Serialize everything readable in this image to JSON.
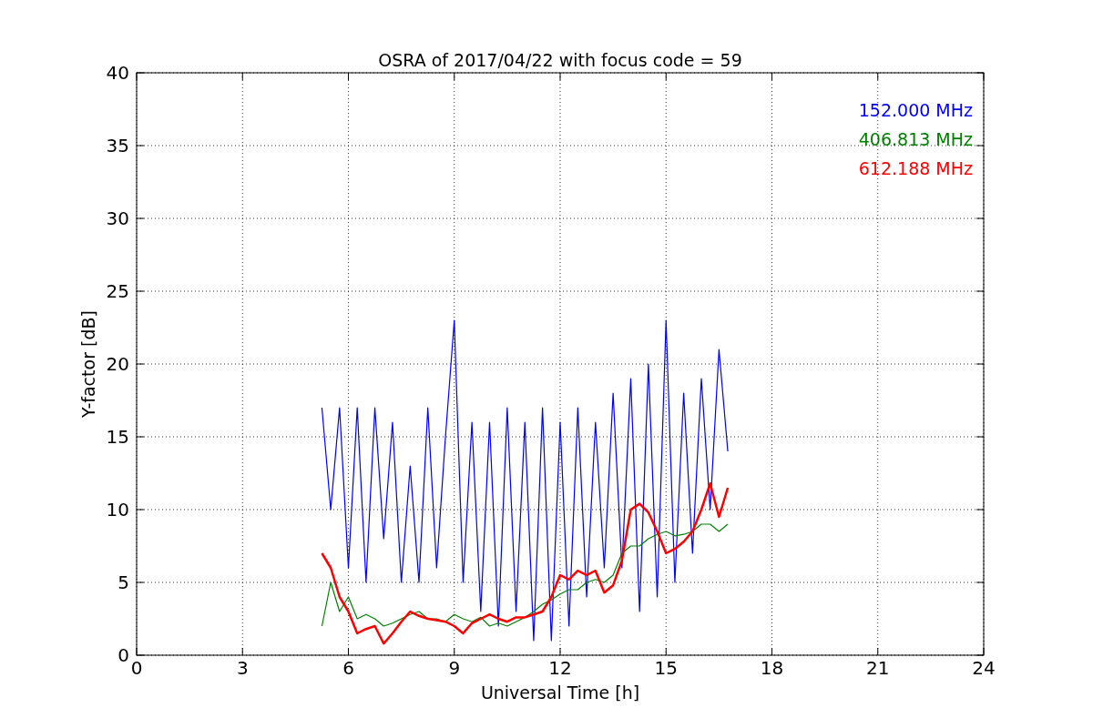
{
  "chart_data": {
    "type": "line",
    "title": "OSRA of 2017/04/22 with focus code = 59",
    "xlabel": "Universal Time [h]",
    "ylabel": "Y-factor [dB]",
    "xlim": [
      0,
      24
    ],
    "ylim": [
      0,
      40
    ],
    "grid": true,
    "xticks": [
      0,
      3,
      6,
      9,
      12,
      15,
      18,
      21,
      24
    ],
    "yticks": [
      0,
      5,
      10,
      15,
      20,
      25,
      30,
      35,
      40
    ],
    "x": [
      5.25,
      5.5,
      5.75,
      6,
      6.25,
      6.5,
      6.75,
      7,
      7.25,
      7.5,
      7.75,
      8,
      8.25,
      8.5,
      8.75,
      9,
      9.25,
      9.5,
      9.75,
      10,
      10.25,
      10.5,
      10.75,
      11,
      11.25,
      11.5,
      11.75,
      12,
      12.25,
      12.5,
      12.75,
      13,
      13.25,
      13.5,
      13.75,
      14,
      14.25,
      14.5,
      14.75,
      15,
      15.25,
      15.5,
      15.75,
      16,
      16.25,
      16.5,
      16.75
    ],
    "series": [
      {
        "name": "152.000 MHz",
        "color": "#0000ff",
        "values": [
          17,
          10,
          17,
          6,
          17,
          5,
          17,
          8,
          16,
          5,
          13,
          5,
          17,
          6,
          15,
          23,
          5,
          16,
          3,
          16,
          2,
          17,
          3,
          16,
          1,
          17,
          1,
          16,
          2,
          17,
          4,
          16,
          6,
          18,
          6,
          19,
          3,
          20,
          4,
          23,
          5,
          18,
          7,
          19,
          10,
          21,
          14
        ]
      },
      {
        "name": "406.813 MHz",
        "color": "#008000",
        "values": [
          2,
          5,
          3,
          4,
          2.5,
          2.8,
          2.5,
          2,
          2.2,
          2.5,
          2.8,
          3,
          2.5,
          2.5,
          2.3,
          2.8,
          2.5,
          2.3,
          2.6,
          2,
          2.2,
          2,
          2.3,
          2.6,
          3,
          3.5,
          3.8,
          4.2,
          4.5,
          4.5,
          5,
          5.2,
          5,
          5.5,
          7,
          7.5,
          7.5,
          8,
          8.3,
          8.5,
          8.2,
          8.3,
          8.5,
          9,
          9,
          8.5,
          9
        ]
      },
      {
        "name": "612.188 MHz",
        "color": "#ff0000",
        "values": [
          7,
          6,
          4,
          3,
          1.5,
          1.8,
          2,
          0.8,
          1.5,
          2.3,
          3,
          2.7,
          2.5,
          2.4,
          2.3,
          2,
          1.5,
          2.2,
          2.5,
          2.8,
          2.5,
          2.3,
          2.6,
          2.6,
          2.8,
          3,
          4,
          5.5,
          5.2,
          5.8,
          5.5,
          5.8,
          4.3,
          4.8,
          6.5,
          10,
          10.4,
          9.8,
          8.5,
          7,
          7.3,
          7.8,
          8.5,
          10,
          11.8,
          9.5,
          11.5
        ]
      }
    ]
  }
}
